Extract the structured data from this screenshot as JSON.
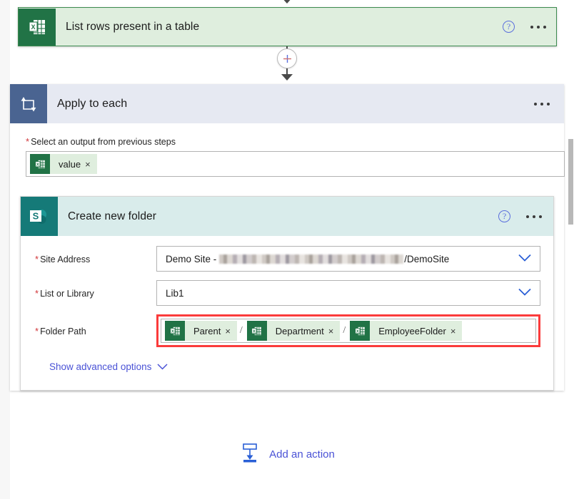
{
  "flow": {
    "excel_step": {
      "title": "List rows present in a table",
      "icon": "excel-icon",
      "help_icon": "?",
      "menu_icon": "ellipsis-icon",
      "accent_color": "#217346",
      "header_background": "#dfeede"
    },
    "insert_button": {
      "label": "+",
      "name": "insert-new-step-button"
    },
    "loop_step": {
      "title": "Apply to each",
      "icon": "loop-icon",
      "menu_icon": "ellipsis-icon",
      "accent_color": "#4a6491",
      "header_background": "#e6e9f2",
      "output_field": {
        "label": "Select an output from previous steps",
        "required": true,
        "required_marker": "*",
        "tokens": [
          {
            "text": "value",
            "icon": "excel-icon",
            "remove_label": "×"
          }
        ]
      }
    },
    "sharepoint_step": {
      "title": "Create new folder",
      "icon": "sharepoint-icon",
      "help_icon": "?",
      "menu_icon": "ellipsis-icon",
      "accent_color": "#157a78",
      "header_background": "#d9eceb",
      "fields": [
        {
          "label": "Site Address",
          "required_marker": "*",
          "type": "dropdown",
          "value_prefix": "Demo Site - ",
          "value_redacted": true,
          "value_suffix": "/DemoSite",
          "chevron": "chevron-down-icon"
        },
        {
          "label": "List or Library",
          "required_marker": "*",
          "type": "dropdown",
          "value": "Lib1",
          "chevron": "chevron-down-icon"
        }
      ],
      "folder_path": {
        "label": "Folder Path",
        "required_marker": "*",
        "highlighted": true,
        "highlight_color": "#fb3b3b",
        "tokens": [
          {
            "text": "Parent",
            "icon": "excel-icon",
            "remove_label": "×"
          },
          {
            "text": "Department",
            "icon": "excel-icon",
            "remove_label": "×"
          },
          {
            "text": "EmployeeFolder",
            "icon": "excel-icon",
            "remove_label": "×"
          }
        ],
        "separator": "/"
      },
      "advanced_options": {
        "label": "Show advanced options",
        "chevron": "chevron-down-icon"
      }
    },
    "add_action": {
      "label": "Add an action",
      "icon": "add-step-icon",
      "color": "#4a52d6"
    }
  }
}
